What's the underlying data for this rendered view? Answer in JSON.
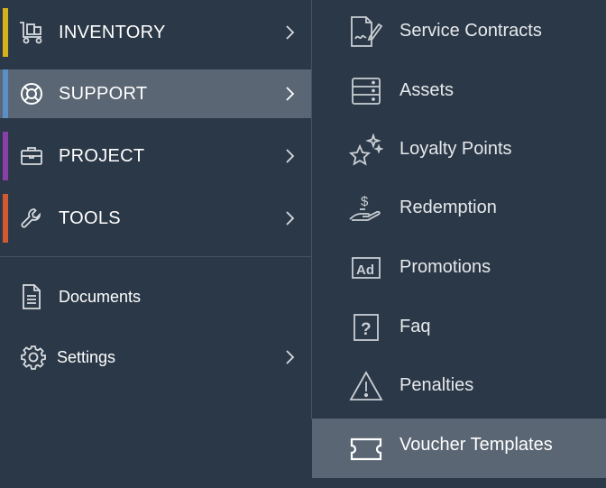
{
  "main_menu": [
    {
      "label": "INVENTORY",
      "icon": "dolly-cart-icon",
      "accent": "#d6b21a"
    },
    {
      "label": "SUPPORT",
      "icon": "lifebuoy-icon",
      "accent": "#5b8fc9"
    },
    {
      "label": "PROJECT",
      "icon": "briefcase-icon",
      "accent": "#8a3fa8"
    },
    {
      "label": "TOOLS",
      "icon": "wrench-icon",
      "accent": "#d05a32"
    }
  ],
  "secondary_menu": [
    {
      "label": "Documents",
      "icon": "document-icon"
    },
    {
      "label": "Settings",
      "icon": "gear-icon"
    }
  ],
  "support_submenu": [
    {
      "label": "Service Contracts",
      "icon": "contract-signature-icon"
    },
    {
      "label": "Assets",
      "icon": "server-stack-icon"
    },
    {
      "label": "Loyalty Points",
      "icon": "sparkle-stars-icon"
    },
    {
      "label": "Redemption",
      "icon": "hand-dollar-icon"
    },
    {
      "label": "Promotions",
      "icon": "ad-badge-icon"
    },
    {
      "label": "Faq",
      "icon": "question-box-icon"
    },
    {
      "label": "Penalties",
      "icon": "warning-triangle-icon"
    },
    {
      "label": "Voucher Templates",
      "icon": "ticket-icon"
    }
  ],
  "colors": {
    "background": "#2b3847",
    "active_background": "#5a6673",
    "icon_stroke": "#c9ced4"
  }
}
